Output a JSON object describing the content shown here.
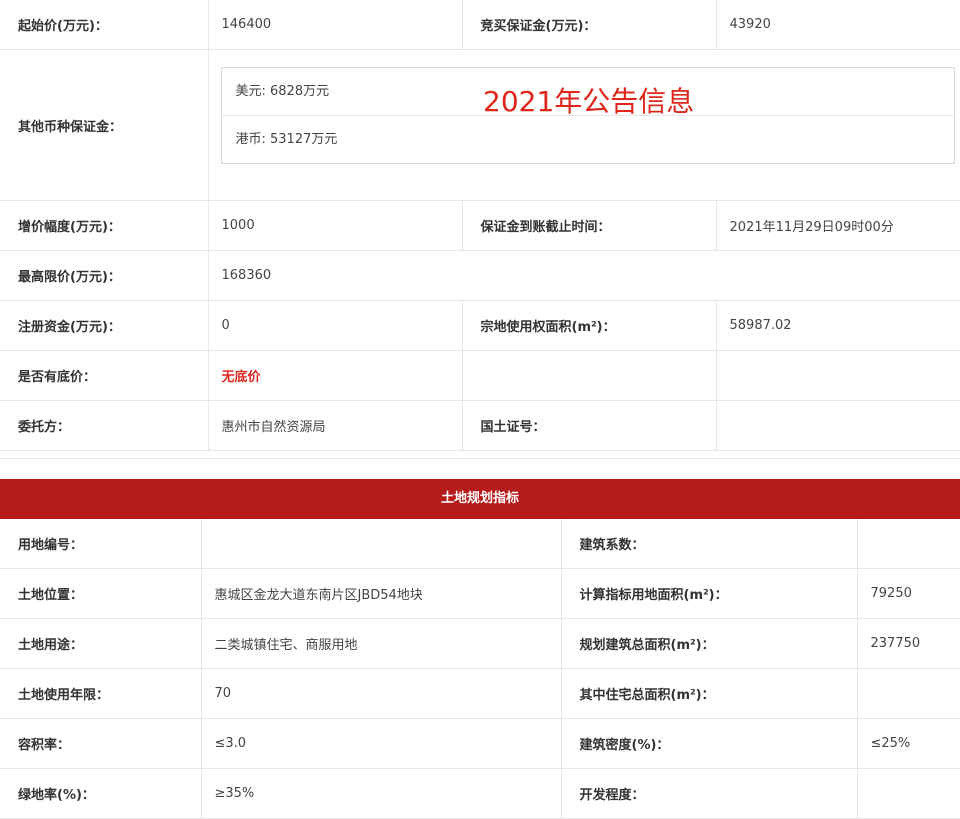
{
  "top": {
    "rows": [
      {
        "l1": "起始价(万元)：",
        "v1": "146400",
        "l2": "竞买保证金(万元)：",
        "v2": "43920"
      },
      {
        "l1": "增价幅度(万元)：",
        "v1": "1000",
        "l2": "保证金到账截止时间：",
        "v2": "2021年11月29日09时00分"
      },
      {
        "l1": "最高限价(万元)：",
        "v1": "168360",
        "l2": "",
        "v2": ""
      },
      {
        "l1": "注册资金(万元)：",
        "v1": "0",
        "l2": "宗地使用权面积(m²)：",
        "v2": "58987.02"
      },
      {
        "l1": "是否有底价：",
        "v1": "无底价",
        "l2": "",
        "v2": ""
      },
      {
        "l1": "委托方：",
        "v1": "惠州市自然资源局",
        "l2": "国土证号：",
        "v2": ""
      }
    ],
    "other_currency": {
      "label": "其他币种保证金：",
      "usd": "美元: 6828万元",
      "hkd": "港币: 53127万元"
    }
  },
  "overlay_text": "2021年公告信息",
  "plan": {
    "title": "土地规划指标",
    "rows": [
      {
        "l1": "用地编号：",
        "v1": "",
        "l2": "建筑系数：",
        "v2": ""
      },
      {
        "l1": "土地位置：",
        "v1": "惠城区金龙大道东南片区JBD54地块",
        "l2": "计算指标用地面积(m²)：",
        "v2": "79250"
      },
      {
        "l1": "土地用途：",
        "v1": "二类城镇住宅、商服用地",
        "l2": "规划建筑总面积(m²)：",
        "v2": "237750"
      },
      {
        "l1": "土地使用年限：",
        "v1": "70",
        "l2": "其中住宅总面积(m²)：",
        "v2": ""
      },
      {
        "l1": "容积率：",
        "v1": "≤3.0",
        "l2": "建筑密度(%)：",
        "v2": "≤25%"
      },
      {
        "l1": "绿地率(%)：",
        "v1": "≥35%",
        "l2": "开发程度：",
        "v2": ""
      }
    ]
  }
}
